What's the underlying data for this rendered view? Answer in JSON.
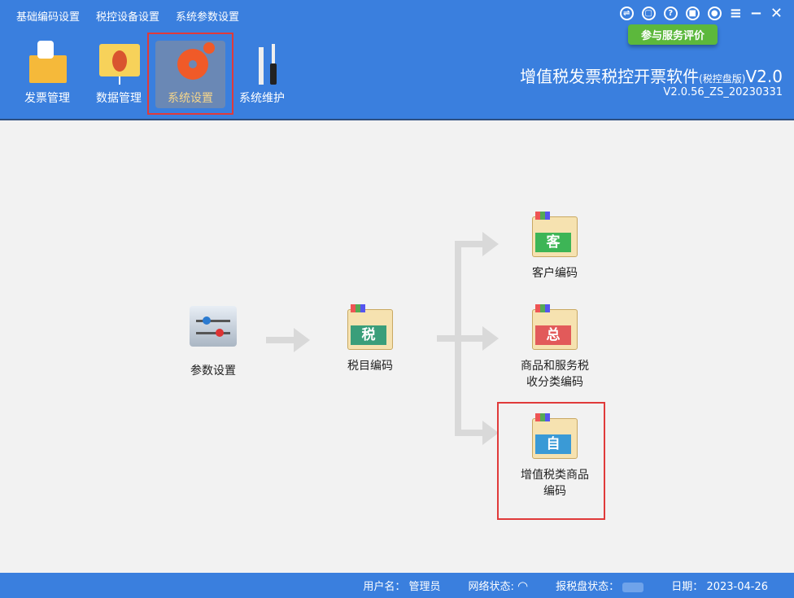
{
  "menu": [
    "基础编码设置",
    "税控设备设置",
    "系统参数设置"
  ],
  "window_controls": [
    "switch-icon",
    "service-icon",
    "help-icon",
    "lock-icon",
    "user-icon",
    "menu-icon",
    "minimize-icon",
    "close-icon"
  ],
  "tooltip": "参与服务评价",
  "toolbar": [
    {
      "label": "发票管理"
    },
    {
      "label": "数据管理"
    },
    {
      "label": "系统设置"
    },
    {
      "label": "系统维护"
    }
  ],
  "app": {
    "title": "增值税发票税控开票软件",
    "edition": "(税控盘版)",
    "version_suffix": "V2.0",
    "build": "V2.0.56_ZS_20230331"
  },
  "flow": {
    "params": "参数设置",
    "tax": {
      "label": "税目编码",
      "char": "税"
    },
    "customer": {
      "label": "客户编码",
      "char": "客"
    },
    "goods": {
      "label1": "商品和服务税",
      "label2": "收分类编码",
      "char": "总"
    },
    "vat_goods": {
      "label1": "增值税类商品",
      "label2": "编码",
      "char": "自"
    }
  },
  "status": {
    "user_label": "用户名：",
    "user": "管理员",
    "net_label": "网络状态:",
    "disk_label": "报税盘状态：",
    "date_label": "日期：",
    "date": "2023-04-26"
  }
}
